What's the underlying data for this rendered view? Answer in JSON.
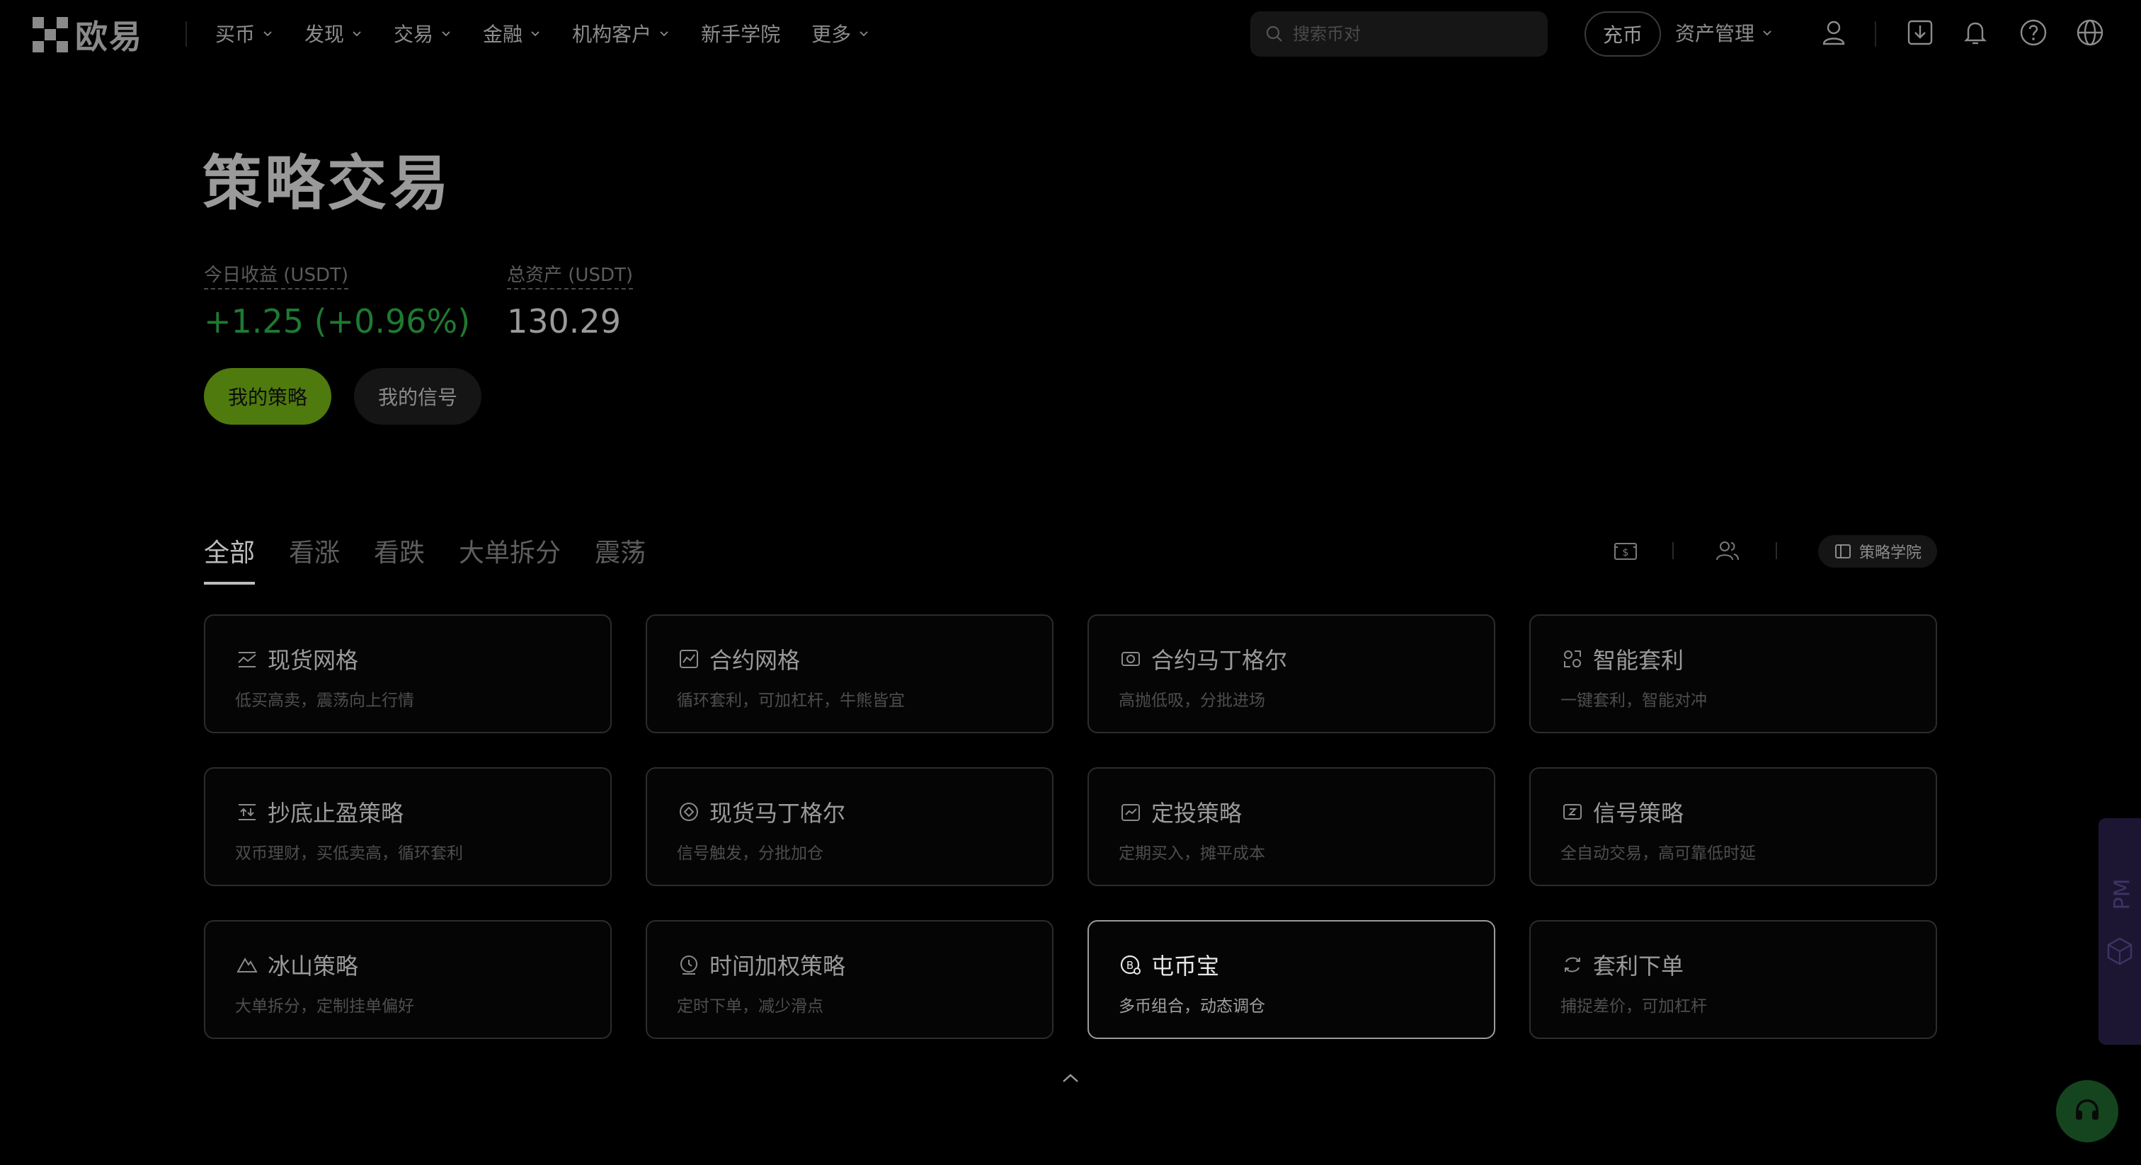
{
  "nav": {
    "logo_text": "欧易",
    "links": [
      {
        "label": "买币",
        "has_dropdown": true
      },
      {
        "label": "发现",
        "has_dropdown": true
      },
      {
        "label": "交易",
        "has_dropdown": true
      },
      {
        "label": "金融",
        "has_dropdown": true
      },
      {
        "label": "机构客户",
        "has_dropdown": true
      },
      {
        "label": "新手学院",
        "has_dropdown": false
      },
      {
        "label": "更多",
        "has_dropdown": true
      }
    ],
    "search_placeholder": "搜索币对",
    "deposit_label": "充币",
    "asset_mgmt_label": "资产管理",
    "icons": [
      "user-icon",
      "download-icon",
      "bell-icon",
      "help-icon",
      "globe-icon"
    ]
  },
  "header": {
    "title": "策略交易",
    "today_pnl_label": "今日收益 (USDT)",
    "today_pnl_value": "+1.25 (+0.96%)",
    "total_assets_label": "总资产 (USDT)",
    "total_assets_value": "130.29",
    "my_strategies_label": "我的策略",
    "my_signals_label": "我的信号"
  },
  "tabs": [
    {
      "label": "全部",
      "active": true
    },
    {
      "label": "看涨",
      "active": false
    },
    {
      "label": "看跌",
      "active": false
    },
    {
      "label": "大单拆分",
      "active": false
    },
    {
      "label": "震荡",
      "active": false
    }
  ],
  "toolbar": {
    "academy_label": "策略学院"
  },
  "cards": [
    {
      "title": "现货网格",
      "desc": "低买高卖，震荡向上行情",
      "icon": "grid-chart-icon"
    },
    {
      "title": "合约网格",
      "desc": "循环套利，可加杠杆，牛熊皆宜",
      "icon": "contract-grid-icon"
    },
    {
      "title": "合约马丁格尔",
      "desc": "高抛低吸，分批进场",
      "icon": "contract-martingale-icon"
    },
    {
      "title": "智能套利",
      "desc": "一键套利，智能对冲",
      "icon": "smart-arbitrage-icon"
    },
    {
      "title": "抄底止盈策略",
      "desc": "双币理财，买低卖高，循环套利",
      "icon": "bottom-fishing-icon"
    },
    {
      "title": "现货马丁格尔",
      "desc": "信号触发，分批加仓",
      "icon": "spot-martingale-icon"
    },
    {
      "title": "定投策略",
      "desc": "定期买入，摊平成本",
      "icon": "recurring-buy-icon"
    },
    {
      "title": "信号策略",
      "desc": "全自动交易，高可靠低时延",
      "icon": "signal-icon"
    },
    {
      "title": "冰山策略",
      "desc": "大单拆分，定制挂单偏好",
      "icon": "iceberg-icon"
    },
    {
      "title": "时间加权策略",
      "desc": "定时下单，减少滑点",
      "icon": "twap-clock-icon"
    },
    {
      "title": "屯币宝",
      "desc": "多币组合，动态调仓",
      "icon": "coin-portfolio-icon",
      "highlight": true
    },
    {
      "title": "套利下单",
      "desc": "捕捉差价，可加杠杆",
      "icon": "arbitrage-order-icon"
    }
  ],
  "side": {
    "pm_label": "PM"
  },
  "colors": {
    "background": "#000000",
    "accent_green": "#4f7a0e",
    "profit_green": "#1e7a32",
    "side_panel": "#1d1633",
    "support_button": "#14451f"
  }
}
